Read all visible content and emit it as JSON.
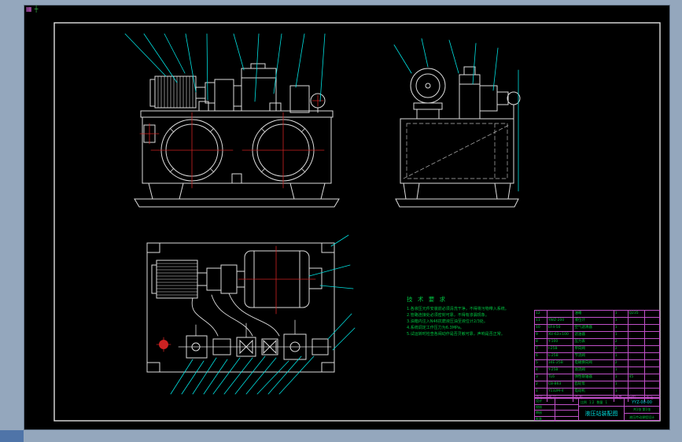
{
  "app": {
    "background": "#94a7bd",
    "canvas_background": "#000000",
    "line_colors": {
      "outline": "#e0e0e0",
      "leader": "#00e0e0",
      "centerline": "#cc2222",
      "annotation": "#00c040",
      "table_grid": "#c050c8"
    }
  },
  "toolbar_icons": [
    {
      "name": "grid-icon",
      "glyph": "▦",
      "color": "#cf5fd0"
    },
    {
      "name": "crosshair-icon",
      "glyph": "┼",
      "color": "#37b54a"
    }
  ],
  "notes": {
    "title": "技 术 要 求",
    "lines": [
      "1.各液压元件安装前必须清洗干净，不得将污物带入系统。",
      "2.管路连接处必须密封可靠，不得有渗漏现象。",
      "3.油箱内注入N46抗磨液压油至液位计2/3处。",
      "4.系统调定工作压力为6.3MPa。",
      "5.试运转时检查各阀动作是否灵敏可靠，声响是否正常。"
    ]
  },
  "parts_list": {
    "headers": [
      "序号",
      "代  号",
      "名  称",
      "数量",
      "材料",
      "备注"
    ],
    "rows": [
      [
        "12",
        "",
        "油箱",
        "1",
        "Q235",
        ""
      ],
      [
        "11",
        "YWZ-200",
        "液位计",
        "1",
        "",
        ""
      ],
      [
        "10",
        "EF4-50",
        "空气滤清器",
        "1",
        "",
        ""
      ],
      [
        "9",
        "XU-63×100",
        "滤油器",
        "1",
        "",
        ""
      ],
      [
        "8",
        "Y-100",
        "压力表",
        "2",
        "",
        ""
      ],
      [
        "7",
        "I-25B",
        "单向阀",
        "2",
        "",
        ""
      ],
      [
        "6",
        "L-25B",
        "节流阀",
        "1",
        "",
        ""
      ],
      [
        "5",
        "34E-25B",
        "电磁换向阀",
        "2",
        "",
        ""
      ],
      [
        "4",
        "Y-25B",
        "溢流阀",
        "1",
        "",
        ""
      ],
      [
        "3",
        "TL6",
        "弹性联轴器",
        "1",
        "45",
        ""
      ],
      [
        "2",
        "CB-B63",
        "齿轮泵",
        "1",
        "",
        ""
      ],
      [
        "1",
        "Y132M-4",
        "电动机",
        "1",
        "",
        ""
      ]
    ]
  },
  "title_block": {
    "title": "液压站装配图",
    "drawing_no": "YYZ-00-00",
    "design_label": "设计",
    "check_label": "校核",
    "review_label": "审核",
    "approve_label": "批准",
    "scale_label": "比例",
    "scale_value": "1:2",
    "qty_label": "数量",
    "qty_value": "1",
    "sheet_info": "共1张 第1张",
    "org": "液压传动课程设计"
  }
}
